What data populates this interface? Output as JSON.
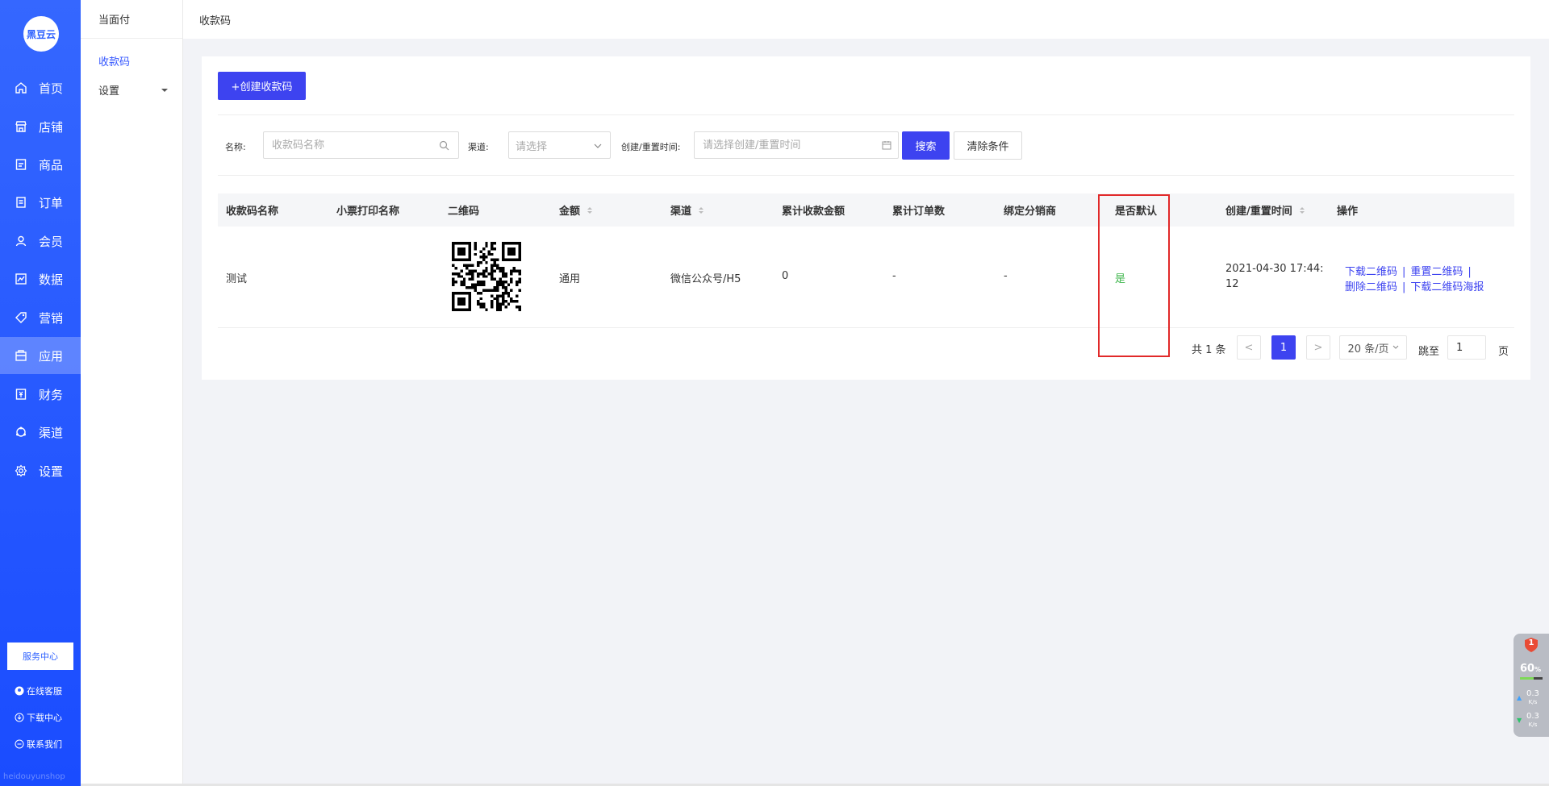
{
  "logo": {
    "text": "黑豆云"
  },
  "sidebar": {
    "items": [
      {
        "label": "首页",
        "icon": "home-icon"
      },
      {
        "label": "店铺",
        "icon": "store-icon"
      },
      {
        "label": "商品",
        "icon": "goods-icon"
      },
      {
        "label": "订单",
        "icon": "order-icon"
      },
      {
        "label": "会员",
        "icon": "member-icon"
      },
      {
        "label": "数据",
        "icon": "data-icon"
      },
      {
        "label": "营销",
        "icon": "tag-icon"
      },
      {
        "label": "应用",
        "icon": "app-icon",
        "active": true
      },
      {
        "label": "财务",
        "icon": "finance-icon"
      },
      {
        "label": "渠道",
        "icon": "channel-icon"
      },
      {
        "label": "设置",
        "icon": "gear-icon"
      }
    ],
    "service_button": "服务中心",
    "links": [
      {
        "label": "在线客服",
        "icon": "avatar-icon"
      },
      {
        "label": "下载中心",
        "icon": "download-icon"
      },
      {
        "label": "联系我们",
        "icon": "chat-icon"
      }
    ],
    "watermark": "heidouyunshop"
  },
  "subnav": {
    "title": "当面付",
    "items": [
      {
        "label": "收款码",
        "active": true
      },
      {
        "label": "设置"
      }
    ]
  },
  "topbar": {
    "breadcrumb": "收款码"
  },
  "toolbar": {
    "create_label": "+创建收款码"
  },
  "filters": {
    "name_label": "名称:",
    "name_placeholder": "收款码名称",
    "channel_label": "渠道:",
    "channel_placeholder": "请选择",
    "time_label": "创建/重置时间:",
    "time_placeholder": "请选择创建/重置时间",
    "search_label": "搜索",
    "clear_label": "清除条件"
  },
  "table": {
    "headers": [
      "收款码名称",
      "小票打印名称",
      "二维码",
      "金额",
      "渠道",
      "累计收款金额",
      "累计订单数",
      "绑定分销商",
      "是否默认",
      "创建/重置时间",
      "操作"
    ],
    "rows": [
      {
        "name": "测试",
        "print_name": "",
        "amount": "通用",
        "channel": "微信公众号/H5",
        "total_amount": "0",
        "total_orders": "-",
        "distributor": "-",
        "is_default": "是",
        "time_line1": "2021-04-30 17:44:",
        "time_line2": "12",
        "actions": [
          "下载二维码",
          "重置二维码",
          "删除二维码",
          "下载二维码海报"
        ]
      }
    ]
  },
  "pagination": {
    "total": "共 1 条",
    "prev": "<",
    "current": "1",
    "next": ">",
    "page_size": "20 条/页",
    "jump_label": "跳至",
    "jump_value": "1",
    "page_unit": "页"
  },
  "widget": {
    "badge": "1",
    "percent": "60",
    "percent_unit": "%",
    "usage_level": 0.6,
    "up_speed": "0.3",
    "down_speed": "0.3",
    "speed_unit": "K/s"
  }
}
